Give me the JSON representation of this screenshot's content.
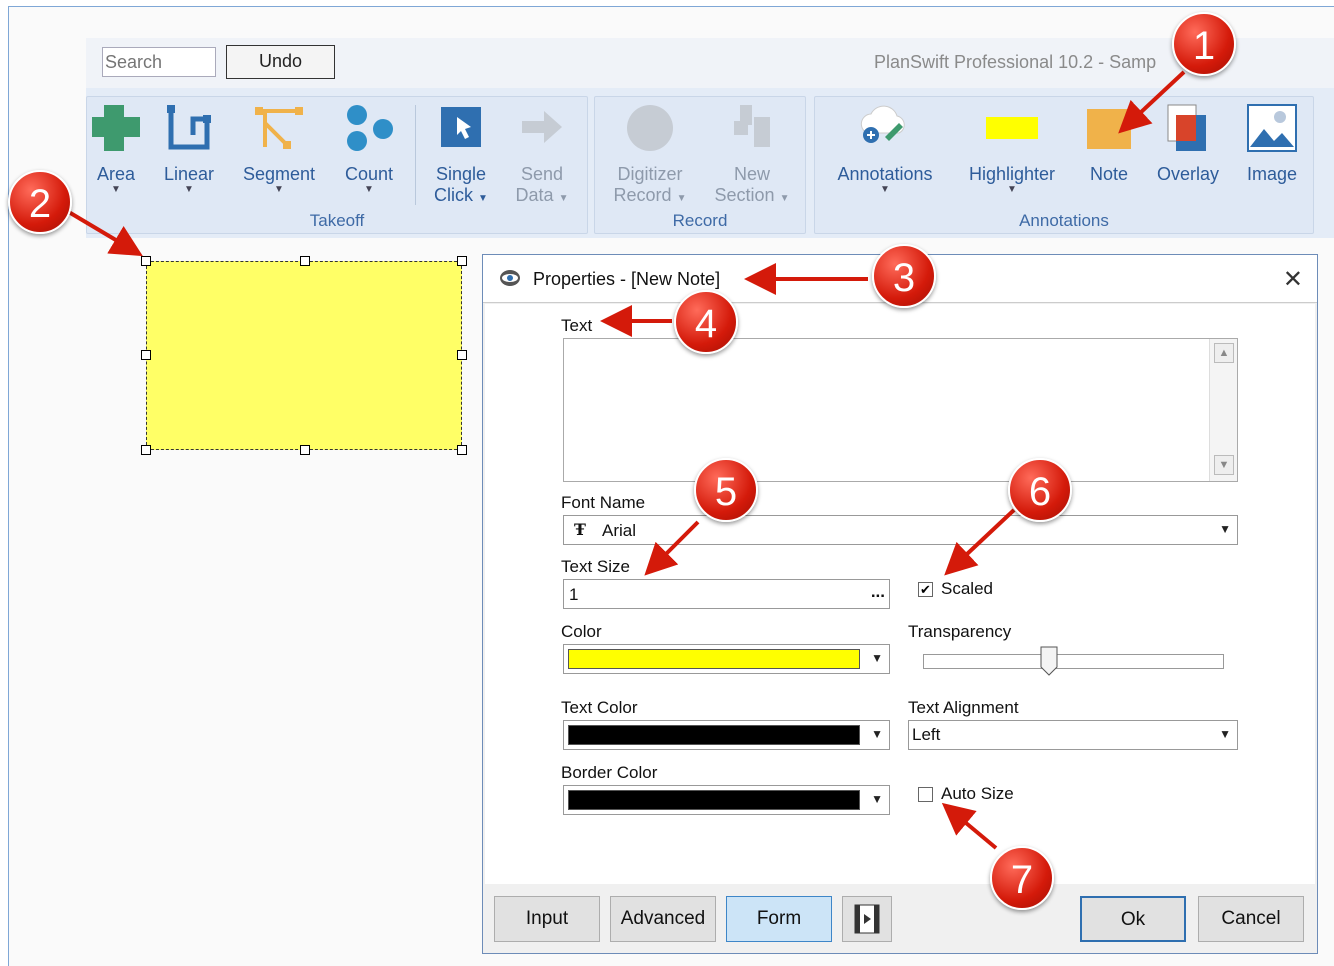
{
  "toolbar": {
    "search_placeholder": "Search",
    "undo_label": "Undo",
    "app_title": "PlanSwift Professional 10.2 - Samp"
  },
  "ribbon": {
    "takeoff": {
      "label": "Takeoff",
      "area": "Area",
      "linear": "Linear",
      "segment": "Segment",
      "count": "Count",
      "single1": "Single",
      "single2": "Click",
      "send1": "Send",
      "send2": "Data"
    },
    "record": {
      "label": "Record",
      "dig1": "Digitizer",
      "dig2": "Record",
      "new1": "New",
      "new2": "Section"
    },
    "annotations": {
      "label": "Annotations",
      "annotations": "Annotations",
      "highlighter": "Highlighter",
      "note": "Note",
      "overlay": "Overlay",
      "image": "Image"
    }
  },
  "dialog": {
    "title": "Properties - [New Note]",
    "text_label": "Text",
    "text_value": "",
    "font_name_label": "Font Name",
    "font_name_value": "Arial",
    "text_size_label": "Text Size",
    "text_size_value": "1",
    "scaled_label": "Scaled",
    "scaled_checked": true,
    "color_label": "Color",
    "color_value": "#ffff00",
    "transparency_label": "Transparency",
    "transparency_level": 0.42,
    "text_color_label": "Text Color",
    "text_color_value": "#000000",
    "text_alignment_label": "Text Alignment",
    "text_alignment_value": "Left",
    "border_color_label": "Border Color",
    "border_color_value": "#000000",
    "auto_size_label": "Auto Size",
    "auto_size_checked": false,
    "buttons": {
      "input": "Input",
      "advanced": "Advanced",
      "form": "Form",
      "ok": "Ok",
      "cancel": "Cancel"
    }
  },
  "markers": [
    "1",
    "2",
    "3",
    "4",
    "5",
    "6",
    "7"
  ],
  "colors": {
    "accent": "#3e6aa6",
    "note_fill": "#ffff66",
    "marker": "#d41a0a"
  }
}
